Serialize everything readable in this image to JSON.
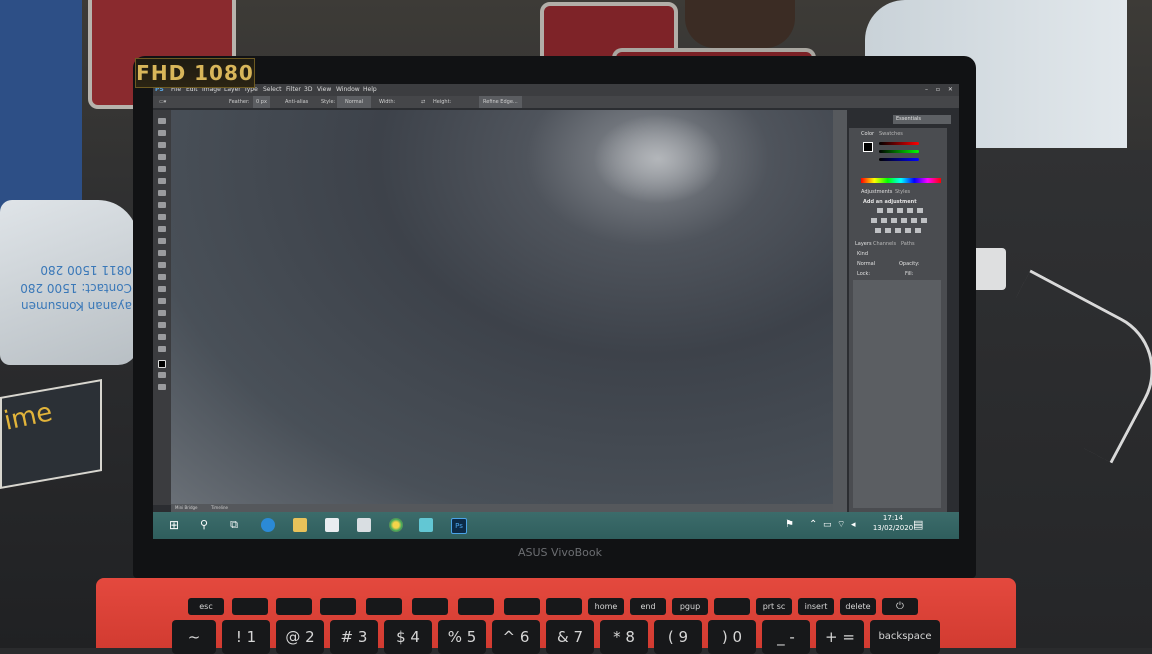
{
  "overlay": {
    "resolution_badge": "FHD 1080"
  },
  "laptop": {
    "brand": "ASUS VivoBook"
  },
  "background": {
    "bag_text": "ayanan Konsumen\nContact: 1500 280\n0811 1500 280",
    "book_text": "ime"
  },
  "photoshop": {
    "menu": [
      "PS",
      "File",
      "Edit",
      "Image",
      "Layer",
      "Type",
      "Select",
      "Filter",
      "3D",
      "View",
      "Window",
      "Help"
    ],
    "options": {
      "feather_label": "Feather:",
      "feather_value": "0 px",
      "anti_alias": "Anti-alias",
      "style_label": "Style:",
      "style_value": "Normal",
      "width_label": "Width:",
      "height_label": "Height:",
      "refine_edge": "Refine Edge..."
    },
    "workspace": "Essentials",
    "panels": {
      "color_tab": "Color",
      "swatches_tab": "Swatches",
      "adjustments_tab": "Adjustments",
      "styles_tab": "Styles",
      "add_adjustment": "Add an adjustment",
      "layers_tab": "Layers",
      "channels_tab": "Channels",
      "paths_tab": "Paths",
      "kind_filter": "Kind",
      "blend_mode": "Normal",
      "opacity_label": "Opacity:",
      "lock_label": "Lock:",
      "fill_label": "Fill:"
    },
    "doc_tabs": [
      "Mini Bridge",
      "Timeline"
    ]
  },
  "taskbar": {
    "time": "17:14",
    "date": "13/02/2020"
  },
  "keyboard": {
    "fn_row": [
      "esc",
      "",
      "",
      "",
      "",
      "",
      "",
      "",
      "",
      "",
      "",
      "home",
      "end",
      "pgup",
      "prt sc",
      "insert",
      "delete",
      ""
    ],
    "num_row": [
      "~",
      "! 1",
      "@ 2",
      "# 3",
      "$ 4",
      "% 5",
      "^ 6",
      "& 7",
      "* 8",
      "( 9",
      ") 0",
      "_ -",
      "+ =",
      "backspace"
    ]
  },
  "colors": {
    "base": "#d9433a",
    "taskbar": "#356564",
    "bezel": "#111214"
  }
}
